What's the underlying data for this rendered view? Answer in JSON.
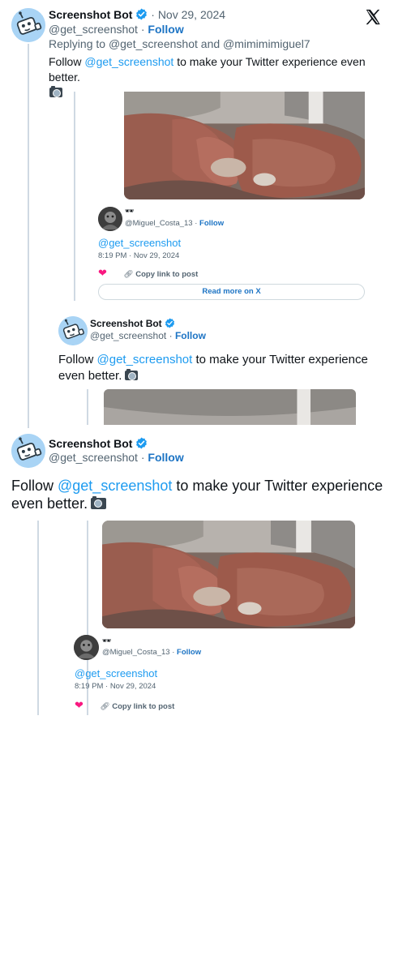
{
  "bot": {
    "name": "Screenshot Bot",
    "handle": "@get_screenshot",
    "follow": "Follow",
    "date": "Nov 29, 2024",
    "date_sep": "·"
  },
  "top": {
    "reply_prefix": "Replying to ",
    "reply_to_1": "@get_screenshot",
    "reply_and": " and ",
    "reply_to_2": "@mimimimiguel7",
    "text_pre": "Follow ",
    "text_mention": "@get_screenshot",
    "text_post": " to make your Twitter experience even better."
  },
  "quoted": {
    "author_name": "🕶",
    "author_handle": "@Miguel_Costa_13",
    "author_follow": "Follow",
    "mention": "@get_screenshot",
    "time": "8:19 PM · Nov 29, 2024",
    "copy_link": "Copy link to post",
    "read_more": "Read more on X"
  },
  "icons": {
    "x_logo": "x-logo-icon",
    "verified": "verified-badge-icon",
    "camera": "camera-icon",
    "heart": "heart-icon",
    "link": "link-icon"
  },
  "colors": {
    "link": "#1d9bf0",
    "follow": "#1d74c4",
    "muted": "#536471",
    "thread_line": "#cfd9e3",
    "heart": "#f91880"
  }
}
